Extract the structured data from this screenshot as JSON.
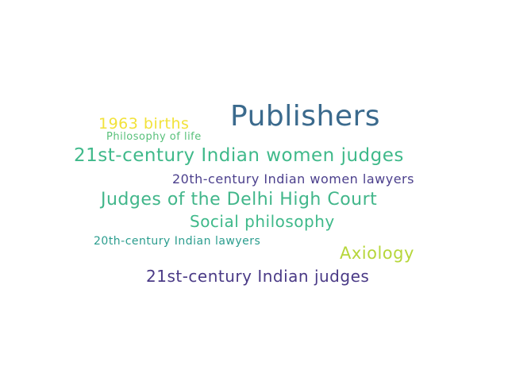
{
  "words": [
    {
      "text": "Publishers",
      "color": "#3b6a8d"
    },
    {
      "text": "1963 births",
      "color": "#f2e23a"
    },
    {
      "text": "Philosophy of life",
      "color": "#58c07a"
    },
    {
      "text": "21st-century Indian women judges",
      "color": "#3fb98a"
    },
    {
      "text": "20th-century Indian women lawyers",
      "color": "#4b3f8c"
    },
    {
      "text": "Judges of the Delhi High Court",
      "color": "#41b68a"
    },
    {
      "text": "Social philosophy",
      "color": "#3fb98a"
    },
    {
      "text": "20th-century Indian lawyers",
      "color": "#2b9d8e"
    },
    {
      "text": "Axiology",
      "color": "#b6d63a"
    },
    {
      "text": "21st-century Indian judges",
      "color": "#4a3a86"
    }
  ]
}
